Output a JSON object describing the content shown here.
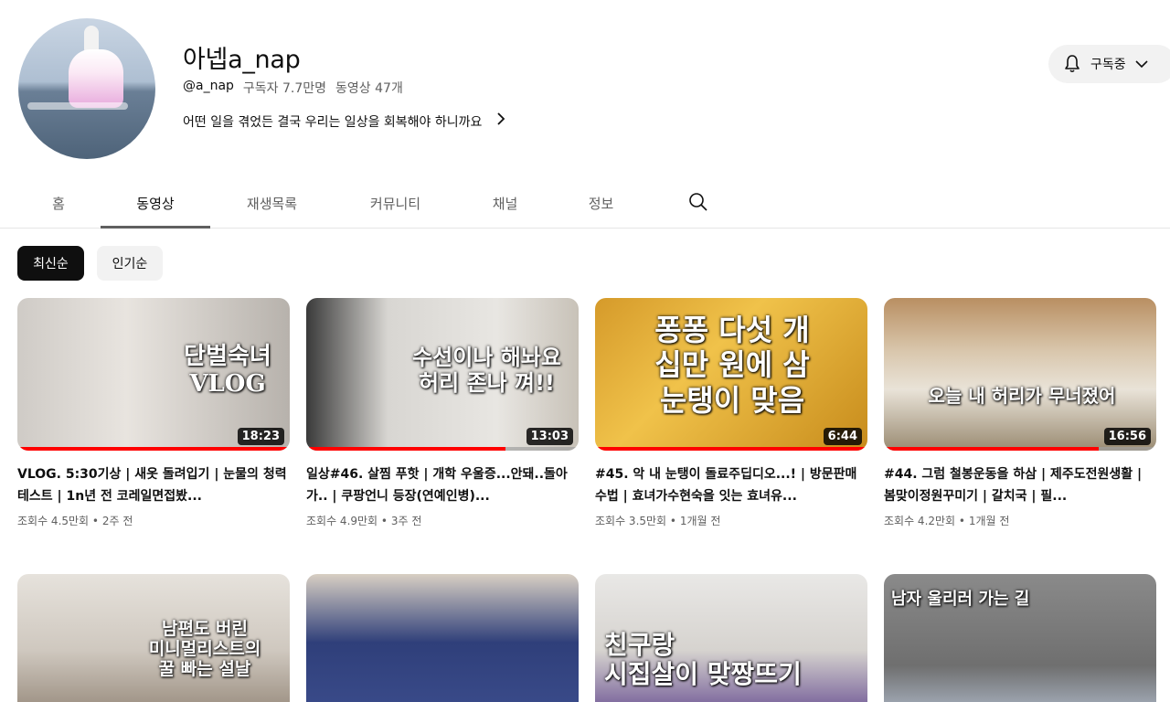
{
  "channel": {
    "name": "아넵a_nap",
    "handle": "@a_nap",
    "subscribers": "구독자 7.7만명",
    "video_count": "동영상 47개",
    "description": "어떤 일을 겪었든 결국 우리는 일상을 회복해야 하니까요",
    "subscribe_label": "구독중"
  },
  "tabs": [
    {
      "label": "홈"
    },
    {
      "label": "동영상"
    },
    {
      "label": "재생목록"
    },
    {
      "label": "커뮤니티"
    },
    {
      "label": "채널"
    },
    {
      "label": "정보"
    }
  ],
  "chips": [
    {
      "label": "최신순"
    },
    {
      "label": "인기순"
    }
  ],
  "videos": [
    {
      "title": "VLOG. 5:30기상 | 새옷 돌려입기 | 눈물의 청력테스트 | 1n년 전 코레일면접봤...",
      "views": "조회수 4.5만회",
      "age": "2주 전",
      "duration": "18:23",
      "thumb_text": "단벌숙녀\nVLOG",
      "progress": 1.0
    },
    {
      "title": "일상#46. 살찜 푸핫 | 개학 우울증...안돼..돌아가.. | 쿠팡언니 등장(연예인병)...",
      "views": "조회수 4.9만회",
      "age": "3주 전",
      "duration": "13:03",
      "thumb_text": "수선이나 해놔요\n허리 존나 껴!!",
      "progress": 0.73
    },
    {
      "title": "#45. 악 내 눈탱이 돌료주딥디오...! | 방문판매수법 | 효녀가수현숙을 잇는 효녀유...",
      "views": "조회수 3.5만회",
      "age": "1개월 전",
      "duration": "6:44",
      "thumb_text": "퐁퐁 다섯 개\n십만 원에 삼\n눈탱이 맞음",
      "progress": 1.0
    },
    {
      "title": "#44. 그럼 철봉운동을 하삼 | 제주도전원생활 | 봄맞이정원꾸미기 | 갈치국 | 필...",
      "views": "조회수 4.2만회",
      "age": "1개월 전",
      "duration": "16:56",
      "thumb_text": "오늘 내 허리가 무너졌어",
      "progress": 0.79
    },
    {
      "thumb_text": "남편도 버린\n미니멀리스트의\n꿀 빠는 설날"
    },
    {
      "thumb_text": ""
    },
    {
      "thumb_text": "친구랑\n시집살이 맞짱뜨기"
    },
    {
      "thumb_text": "남자 울리러 가는 길"
    }
  ]
}
